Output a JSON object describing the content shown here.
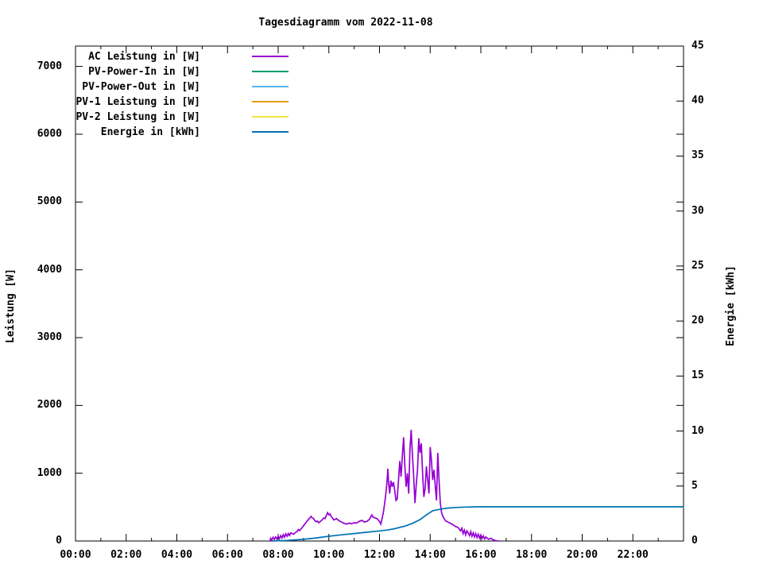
{
  "title": "Tagesdiagramm vom 2022-11-08",
  "colors": {
    "foreground": "#000000",
    "background": "#ffffff",
    "ac": "#9400d3",
    "pv_power_in": "#009e73",
    "pv_power_out": "#56b4e9",
    "pv1": "#e69f00",
    "pv2": "#f0e442",
    "energie": "#0072b2"
  },
  "chart_data": {
    "type": "line",
    "title": "Tagesdiagramm vom 2022-11-08",
    "grid": false,
    "legend_position": "top-left-inside",
    "x_axis": {
      "unit": "time-of-day",
      "range_hours": [
        0,
        24
      ],
      "major_tick_hours": 2,
      "minor_tick_hours": 1,
      "tick_labels": [
        "00:00",
        "02:00",
        "04:00",
        "06:00",
        "08:00",
        "10:00",
        "12:00",
        "14:00",
        "16:00",
        "18:00",
        "20:00",
        "22:00"
      ]
    },
    "y_left": {
      "label": "Leistung [W]",
      "range": [
        0,
        7300
      ],
      "tick_step": 1000,
      "tick_values": [
        0,
        1000,
        2000,
        3000,
        4000,
        5000,
        6000,
        7000
      ],
      "tick_labels": [
        "0",
        "1000",
        "2000",
        "3000",
        "4000",
        "5000",
        "6000",
        "7000"
      ]
    },
    "y_right": {
      "label": "Energie [kWh]",
      "range": [
        0,
        45
      ],
      "tick_step": 5,
      "tick_values": [
        0,
        5,
        10,
        15,
        20,
        25,
        30,
        35,
        40,
        45
      ],
      "tick_labels": [
        "0",
        "5",
        "10",
        "15",
        "20",
        "25",
        "30",
        "35",
        "40",
        "45"
      ]
    },
    "series": [
      {
        "name": "AC Leistung in [W]",
        "color": "#9400d3",
        "axis": "left",
        "unit": "W",
        "visible_in_plot": true,
        "points": [
          [
            7.68,
            0
          ],
          [
            7.7,
            40
          ],
          [
            7.75,
            15
          ],
          [
            7.8,
            55
          ],
          [
            7.85,
            25
          ],
          [
            7.9,
            60
          ],
          [
            7.95,
            30
          ],
          [
            8.0,
            70
          ],
          [
            8.05,
            35
          ],
          [
            8.1,
            80
          ],
          [
            8.15,
            45
          ],
          [
            8.2,
            95
          ],
          [
            8.25,
            55
          ],
          [
            8.3,
            105
          ],
          [
            8.35,
            70
          ],
          [
            8.4,
            110
          ],
          [
            8.45,
            80
          ],
          [
            8.5,
            120
          ],
          [
            8.6,
            100
          ],
          [
            8.7,
            130
          ],
          [
            8.75,
            140
          ],
          [
            8.8,
            170
          ],
          [
            8.85,
            155
          ],
          [
            8.95,
            200
          ],
          [
            9.05,
            250
          ],
          [
            9.15,
            300
          ],
          [
            9.25,
            340
          ],
          [
            9.3,
            363
          ],
          [
            9.35,
            340
          ],
          [
            9.4,
            330
          ],
          [
            9.45,
            300
          ],
          [
            9.5,
            285
          ],
          [
            9.55,
            295
          ],
          [
            9.6,
            270
          ],
          [
            9.7,
            300
          ],
          [
            9.8,
            340
          ],
          [
            9.85,
            330
          ],
          [
            9.9,
            380
          ],
          [
            9.95,
            420
          ],
          [
            10.0,
            385
          ],
          [
            10.05,
            400
          ],
          [
            10.1,
            360
          ],
          [
            10.2,
            310
          ],
          [
            10.3,
            330
          ],
          [
            10.4,
            300
          ],
          [
            10.5,
            280
          ],
          [
            10.6,
            260
          ],
          [
            10.7,
            250
          ],
          [
            10.8,
            265
          ],
          [
            10.9,
            255
          ],
          [
            11.0,
            270
          ],
          [
            11.1,
            265
          ],
          [
            11.2,
            290
          ],
          [
            11.3,
            305
          ],
          [
            11.4,
            280
          ],
          [
            11.5,
            290
          ],
          [
            11.6,
            320
          ],
          [
            11.7,
            385
          ],
          [
            11.75,
            350
          ],
          [
            11.8,
            345
          ],
          [
            11.9,
            330
          ],
          [
            12.0,
            290
          ],
          [
            12.05,
            250
          ],
          [
            12.1,
            330
          ],
          [
            12.15,
            420
          ],
          [
            12.2,
            550
          ],
          [
            12.25,
            700
          ],
          [
            12.3,
            900
          ],
          [
            12.33,
            1065
          ],
          [
            12.36,
            850
          ],
          [
            12.4,
            700
          ],
          [
            12.45,
            890
          ],
          [
            12.5,
            800
          ],
          [
            12.55,
            870
          ],
          [
            12.6,
            750
          ],
          [
            12.65,
            600
          ],
          [
            12.7,
            620
          ],
          [
            12.75,
            900
          ],
          [
            12.8,
            1180
          ],
          [
            12.85,
            950
          ],
          [
            12.9,
            1250
          ],
          [
            12.95,
            1530
          ],
          [
            13.0,
            1100
          ],
          [
            13.05,
            800
          ],
          [
            13.1,
            1000
          ],
          [
            13.15,
            700
          ],
          [
            13.2,
            1350
          ],
          [
            13.25,
            1640
          ],
          [
            13.3,
            1280
          ],
          [
            13.35,
            950
          ],
          [
            13.4,
            560
          ],
          [
            13.45,
            830
          ],
          [
            13.5,
            1050
          ],
          [
            13.55,
            1515
          ],
          [
            13.6,
            1300
          ],
          [
            13.65,
            1440
          ],
          [
            13.7,
            1000
          ],
          [
            13.75,
            650
          ],
          [
            13.8,
            780
          ],
          [
            13.85,
            1100
          ],
          [
            13.9,
            900
          ],
          [
            13.95,
            700
          ],
          [
            14.0,
            1385
          ],
          [
            14.05,
            1200
          ],
          [
            14.1,
            900
          ],
          [
            14.15,
            1050
          ],
          [
            14.2,
            820
          ],
          [
            14.25,
            600
          ],
          [
            14.3,
            1300
          ],
          [
            14.35,
            900
          ],
          [
            14.4,
            560
          ],
          [
            14.45,
            420
          ],
          [
            14.5,
            363
          ],
          [
            14.55,
            330
          ],
          [
            14.6,
            300
          ],
          [
            14.7,
            280
          ],
          [
            14.8,
            260
          ],
          [
            14.9,
            240
          ],
          [
            15.0,
            215
          ],
          [
            15.1,
            200
          ],
          [
            15.2,
            150
          ],
          [
            15.25,
            190
          ],
          [
            15.3,
            110
          ],
          [
            15.35,
            160
          ],
          [
            15.4,
            90
          ],
          [
            15.45,
            150
          ],
          [
            15.5,
            120
          ],
          [
            15.55,
            80
          ],
          [
            15.6,
            140
          ],
          [
            15.65,
            70
          ],
          [
            15.7,
            120
          ],
          [
            15.75,
            60
          ],
          [
            15.8,
            110
          ],
          [
            15.85,
            50
          ],
          [
            15.9,
            100
          ],
          [
            15.95,
            45
          ],
          [
            16.0,
            90
          ],
          [
            16.05,
            40
          ],
          [
            16.1,
            75
          ],
          [
            16.15,
            30
          ],
          [
            16.2,
            60
          ],
          [
            16.3,
            25
          ],
          [
            16.4,
            40
          ],
          [
            16.5,
            15
          ],
          [
            16.6,
            5
          ],
          [
            16.7,
            0
          ]
        ]
      },
      {
        "name": "PV-Power-In in [W]",
        "color": "#009e73",
        "axis": "left",
        "unit": "W",
        "visible_in_plot": false,
        "points": []
      },
      {
        "name": "PV-Power-Out in [W]",
        "color": "#56b4e9",
        "axis": "left",
        "unit": "W",
        "visible_in_plot": false,
        "points": []
      },
      {
        "name": "PV-1 Leistung in [W]",
        "color": "#e69f00",
        "axis": "left",
        "unit": "W",
        "visible_in_plot": false,
        "points": []
      },
      {
        "name": "PV-2 Leistung in [W]",
        "color": "#f0e442",
        "axis": "left",
        "unit": "W",
        "visible_in_plot": false,
        "points": []
      },
      {
        "name": "Energie in [kWh]",
        "color": "#0072b2",
        "axis": "right",
        "unit": "kWh",
        "visible_in_plot": true,
        "points": [
          [
            7.8,
            0.01
          ],
          [
            8.3,
            0.05
          ],
          [
            9.0,
            0.15
          ],
          [
            9.5,
            0.28
          ],
          [
            10.0,
            0.43
          ],
          [
            10.5,
            0.56
          ],
          [
            11.0,
            0.68
          ],
          [
            11.5,
            0.8
          ],
          [
            12.0,
            0.92
          ],
          [
            12.3,
            1.0
          ],
          [
            12.6,
            1.12
          ],
          [
            13.0,
            1.35
          ],
          [
            13.3,
            1.6
          ],
          [
            13.6,
            1.95
          ],
          [
            13.9,
            2.45
          ],
          [
            14.1,
            2.75
          ],
          [
            14.4,
            2.9
          ],
          [
            14.7,
            3.0
          ],
          [
            15.0,
            3.05
          ],
          [
            15.5,
            3.09
          ],
          [
            16.0,
            3.11
          ],
          [
            17.0,
            3.11
          ],
          [
            19.0,
            3.11
          ],
          [
            21.0,
            3.11
          ],
          [
            24.0,
            3.11
          ]
        ]
      }
    ]
  }
}
